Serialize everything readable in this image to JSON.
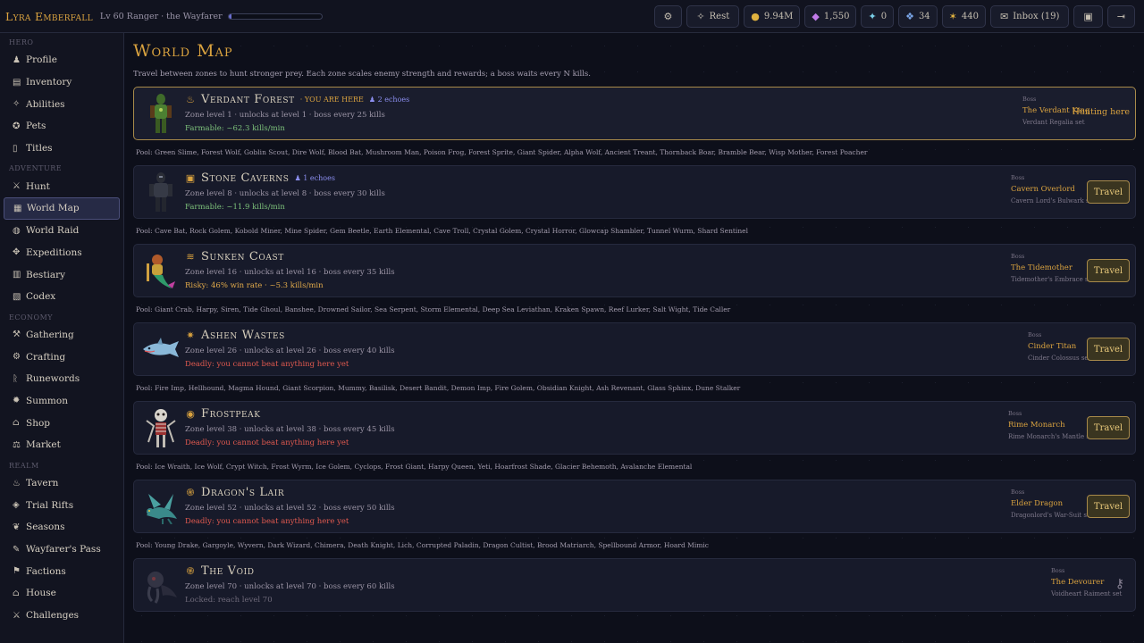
{
  "header": {
    "char_name": "Lyra Emberfall",
    "char_sub": "Lv 60 Ranger · the Wayfarer",
    "xp_fraction": 0.03,
    "rest_label": "Rest",
    "gold": "9.94M",
    "gems": "1,550",
    "res1": "0",
    "res2": "34",
    "res3": "440",
    "inbox": "Inbox (19)"
  },
  "sidebar": {
    "sections": {
      "hero": "HERO",
      "adventure": "ADVENTURE",
      "economy": "ECONOMY",
      "realm": "REALM"
    },
    "items": {
      "profile": "Profile",
      "inventory": "Inventory",
      "abilities": "Abilities",
      "pets": "Pets",
      "titles": "Titles",
      "hunt": "Hunt",
      "worldmap": "World Map",
      "worldraid": "World Raid",
      "expeditions": "Expeditions",
      "bestiary": "Bestiary",
      "codex": "Codex",
      "gathering": "Gathering",
      "crafting": "Crafting",
      "runewords": "Runewords",
      "summon": "Summon",
      "shop": "Shop",
      "market": "Market",
      "tavern": "Tavern",
      "trialrifts": "Trial Rifts",
      "seasons": "Seasons",
      "wayfarerspass": "Wayfarer's Pass",
      "factions": "Factions",
      "house": "House",
      "challenges": "Challenges"
    }
  },
  "page": {
    "title": "World Map",
    "desc": "Travel between zones to hunt stronger prey. Each zone scales enemy strength and rewards; a boss waits every N kills."
  },
  "zones": [
    {
      "name": "Verdant Forest",
      "here": "· YOU ARE HERE",
      "echoes": "2 echoes",
      "meta": "Zone level 1 · unlocks at level 1 · boss every 25 kills",
      "status": "Farmable: ~62.3 kills/min",
      "boss_label": "Boss",
      "boss_name": "The Verdant King",
      "boss_set": "Verdant Regalia set",
      "action": "Hunting here",
      "pool": "Pool: Green Slime, Forest Wolf, Goblin Scout, Dire Wolf, Blood Bat, Mushroom Man, Poison Frog, Forest Sprite, Giant Spider, Alpha Wolf, Ancient Treant, Thornback Boar, Bramble Bear, Wisp Mother, Forest Poacher"
    },
    {
      "name": "Stone Caverns",
      "echoes": "1 echoes",
      "meta": "Zone level 8 · unlocks at level 8 · boss every 30 kills",
      "status": "Farmable: ~11.9 kills/min",
      "boss_label": "Boss",
      "boss_name": "Cavern Overlord",
      "boss_set": "Cavern Lord's Bulwark set",
      "action": "Travel",
      "pool": "Pool: Cave Bat, Rock Golem, Kobold Miner, Mine Spider, Gem Beetle, Earth Elemental, Cave Troll, Crystal Golem, Crystal Horror, Glowcap Shambler, Tunnel Wurm, Shard Sentinel"
    },
    {
      "name": "Sunken Coast",
      "meta": "Zone level 16 · unlocks at level 16 · boss every 35 kills",
      "status": "Risky: 46% win rate · ~5.3 kills/min",
      "boss_label": "Boss",
      "boss_name": "The Tidemother",
      "boss_set": "Tidemother's Embrace set",
      "action": "Travel",
      "pool": "Pool: Giant Crab, Harpy, Siren, Tide Ghoul, Banshee, Drowned Sailor, Sea Serpent, Storm Elemental, Deep Sea Leviathan, Kraken Spawn, Reef Lurker, Salt Wight, Tide Caller"
    },
    {
      "name": "Ashen Wastes",
      "meta": "Zone level 26 · unlocks at level 26 · boss every 40 kills",
      "status": "Deadly: you cannot beat anything here yet",
      "boss_label": "Boss",
      "boss_name": "Cinder Titan",
      "boss_set": "Cinder Colossus set",
      "action": "Travel",
      "pool": "Pool: Fire Imp, Hellhound, Magma Hound, Giant Scorpion, Mummy, Basilisk, Desert Bandit, Demon Imp, Fire Golem, Obsidian Knight, Ash Revenant, Glass Sphinx, Dune Stalker"
    },
    {
      "name": "Frostpeak",
      "meta": "Zone level 38 · unlocks at level 38 · boss every 45 kills",
      "status": "Deadly: you cannot beat anything here yet",
      "boss_label": "Boss",
      "boss_name": "Rime Monarch",
      "boss_set": "Rime Monarch's Mantle set",
      "action": "Travel",
      "pool": "Pool: Ice Wraith, Ice Wolf, Crypt Witch, Frost Wyrm, Ice Golem, Cyclops, Frost Giant, Harpy Queen, Yeti, Hoarfrost Shade, Glacier Behemoth, Avalanche Elemental"
    },
    {
      "name": "Dragon's Lair",
      "meta": "Zone level 52 · unlocks at level 52 · boss every 50 kills",
      "status": "Deadly: you cannot beat anything here yet",
      "boss_label": "Boss",
      "boss_name": "Elder Dragon",
      "boss_set": "Dragonlord's War-Suit set",
      "action": "Travel",
      "pool": "Pool: Young Drake, Gargoyle, Wyvern, Dark Wizard, Chimera, Death Knight, Lich, Corrupted Paladin, Dragon Cultist, Brood Matriarch, Spellbound Armor, Hoard Mimic"
    },
    {
      "name": "The Void",
      "meta": "Zone level 70 · unlocks at level 70 · boss every 60 kills",
      "status": "Locked: reach level 70",
      "boss_label": "Boss",
      "boss_name": "The Devourer",
      "boss_set": "Voidheart Raiment set"
    }
  ]
}
